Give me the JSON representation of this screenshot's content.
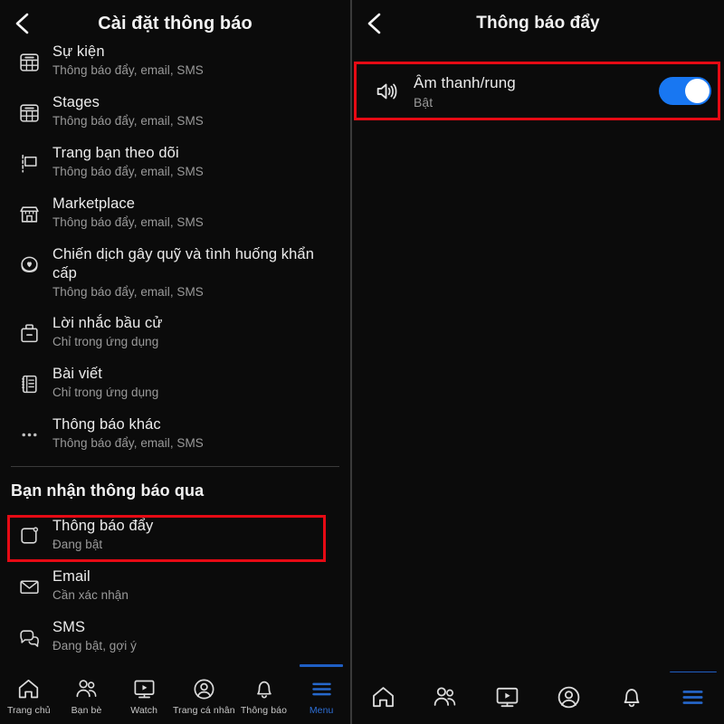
{
  "left_panel": {
    "header": {
      "title": "Cài đặt thông báo",
      "back_icon": "chevron-left-icon"
    },
    "items": [
      {
        "icon": "calendar-grid-icon",
        "title": "Sự kiện",
        "subtitle": "Thông báo đẩy, email, SMS"
      },
      {
        "icon": "calendar-grid-icon",
        "title": "Stages",
        "subtitle": "Thông báo đẩy, email, SMS"
      },
      {
        "icon": "flag-icon",
        "title": "Trang bạn theo dõi",
        "subtitle": "Thông báo đẩy, email, SMS"
      },
      {
        "icon": "storefront-icon",
        "title": "Marketplace",
        "subtitle": "Thông báo đẩy, email, SMS"
      },
      {
        "icon": "heart-coin-icon",
        "title": "Chiến dịch gây quỹ và tình huống khẩn cấp",
        "subtitle": "Thông báo đẩy, email, SMS"
      },
      {
        "icon": "ballot-box-icon",
        "title": "Lời nhắc bầu cử",
        "subtitle": "Chỉ trong ứng dụng"
      },
      {
        "icon": "notebook-icon",
        "title": "Bài viết",
        "subtitle": "Chỉ trong ứng dụng"
      },
      {
        "icon": "ellipsis-icon",
        "title": "Thông báo khác",
        "subtitle": "Thông báo đẩy, email, SMS"
      }
    ],
    "section_header": "Bạn nhận thông báo qua",
    "channels": [
      {
        "icon": "push-notification-icon",
        "title": "Thông báo đẩy",
        "subtitle": "Đang bật",
        "highlighted": true
      },
      {
        "icon": "envelope-icon",
        "title": "Email",
        "subtitle": "Cần xác nhận",
        "highlighted": false
      },
      {
        "icon": "chat-bubbles-icon",
        "title": "SMS",
        "subtitle": "Đang bật, gợi ý",
        "highlighted": false
      }
    ],
    "bottom_nav": [
      {
        "icon": "home-icon",
        "label": "Trang chủ",
        "active": false
      },
      {
        "icon": "people-icon",
        "label": "Bạn bè",
        "active": false
      },
      {
        "icon": "watch-icon",
        "label": "Watch",
        "active": false
      },
      {
        "icon": "profile-icon",
        "label": "Trang cá nhân",
        "active": false
      },
      {
        "icon": "bell-icon",
        "label": "Thông báo",
        "active": false
      },
      {
        "icon": "menu-icon",
        "label": "Menu",
        "active": true
      }
    ]
  },
  "right_panel": {
    "header": {
      "title": "Thông báo đẩy",
      "back_icon": "chevron-left-icon"
    },
    "setting": {
      "icon": "speaker-icon",
      "title": "Âm thanh/rung",
      "subtitle": "Bật",
      "toggle_on": true,
      "highlighted": true
    },
    "bottom_nav": [
      {
        "icon": "home-icon",
        "label": "",
        "active": false
      },
      {
        "icon": "people-icon",
        "label": "",
        "active": false
      },
      {
        "icon": "watch-icon",
        "label": "",
        "active": false
      },
      {
        "icon": "profile-icon",
        "label": "",
        "active": false
      },
      {
        "icon": "bell-icon",
        "label": "",
        "active": false
      },
      {
        "icon": "menu-icon",
        "label": "",
        "active": true
      }
    ]
  },
  "colors": {
    "background": "#0b0b0b",
    "highlight_red": "#e60a14",
    "toggle_blue": "#1877f2",
    "accent_blue": "#2d6fd6",
    "text_primary": "#ececec",
    "text_secondary": "#9a9a9a"
  }
}
